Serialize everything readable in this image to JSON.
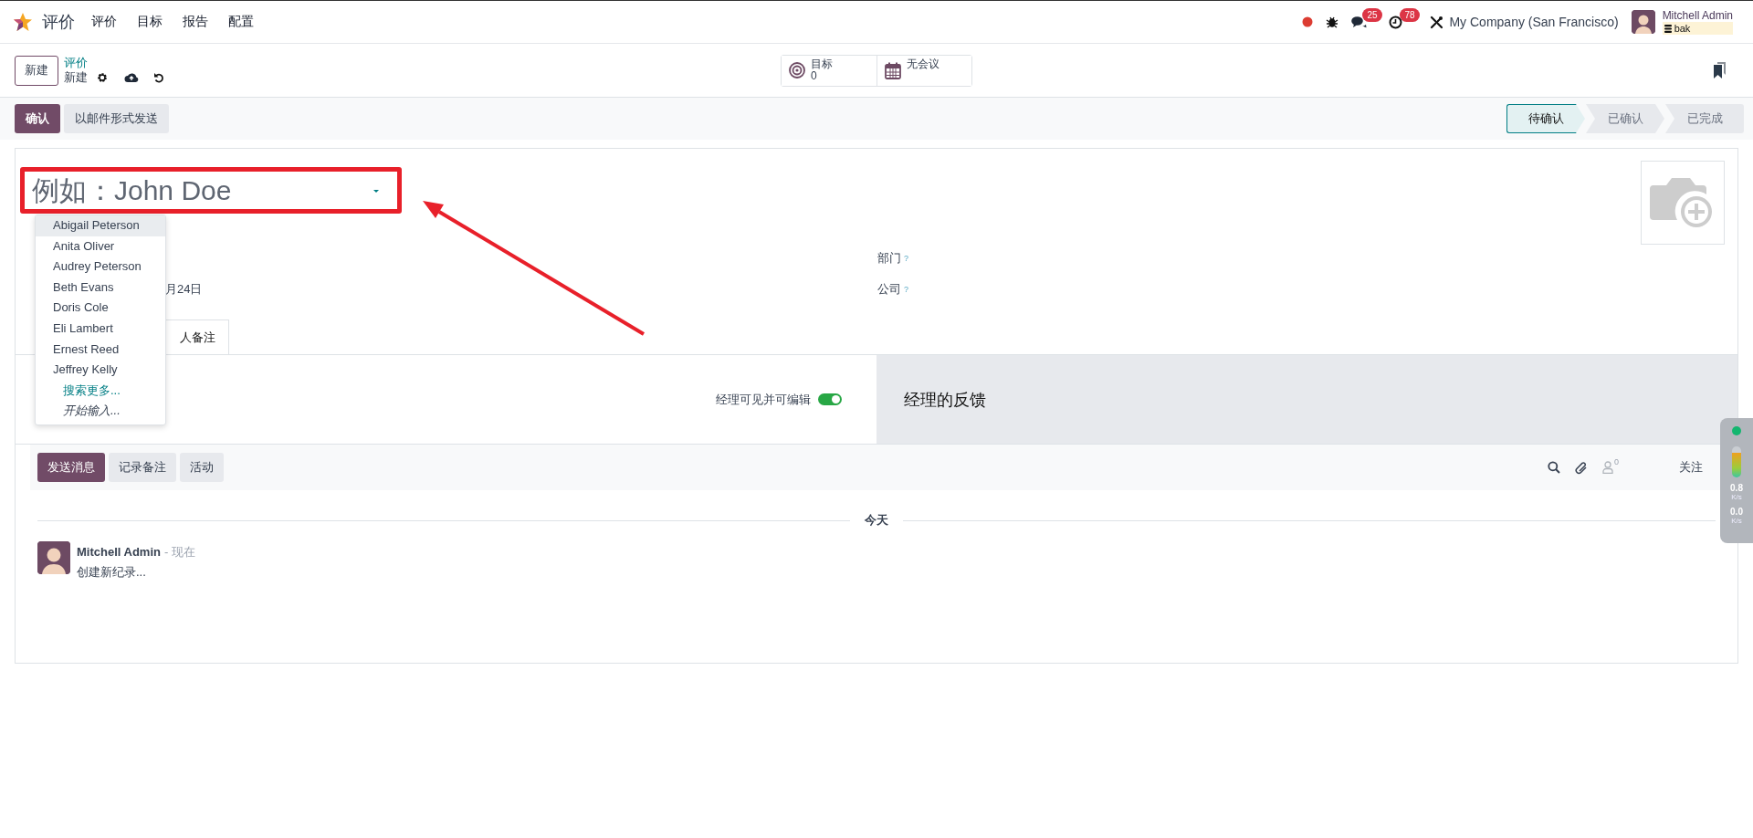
{
  "navbar": {
    "app_name": "评价",
    "menu": [
      "评价",
      "目标",
      "报告",
      "配置"
    ],
    "systray": {
      "chat_count": "25",
      "activity_count": "78",
      "company": "My Company (San Francisco)",
      "user": "Mitchell Admin",
      "database": "bak"
    }
  },
  "control_panel": {
    "new_button": "新建",
    "breadcrumb": "评价",
    "record": "新建",
    "smart_buttons": [
      {
        "kind": "goal",
        "label": "目标",
        "value": "0"
      },
      {
        "kind": "meeting",
        "label": "无会议"
      }
    ]
  },
  "actions": [
    {
      "label": "确认",
      "selected": true
    },
    {
      "label": "以邮件形式发送",
      "selected": false
    }
  ],
  "statusbar": [
    {
      "label": "待确认",
      "selected": true
    },
    {
      "label": "已确认",
      "selected": false
    },
    {
      "label": "已完成",
      "selected": false
    }
  ],
  "form": {
    "name_placeholder": "例如：John Doe",
    "date_fragment": "月24日",
    "fields_right": [
      {
        "label": "部门",
        "help": "?"
      },
      {
        "label": "公司",
        "help": "?"
      }
    ],
    "tab_fragment": "人备注",
    "toggle": {
      "label": "经理可见并可编辑",
      "on": true
    },
    "feedback_title": "经理的反馈"
  },
  "dropdown": {
    "items": [
      {
        "label": "Abigail Peterson",
        "selected": true
      },
      {
        "label": "Anita Oliver",
        "selected": false
      },
      {
        "label": "Audrey Peterson",
        "selected": false
      },
      {
        "label": "Beth Evans",
        "selected": false
      },
      {
        "label": "Doris Cole",
        "selected": false
      },
      {
        "label": "Eli Lambert",
        "selected": false
      },
      {
        "label": "Ernest Reed",
        "selected": false
      },
      {
        "label": "Jeffrey Kelly",
        "selected": false
      }
    ],
    "search_more": "搜索更多...",
    "start_typing": "开始输入..."
  },
  "chatter": {
    "buttons": [
      {
        "label": "发送消息",
        "selected": true
      },
      {
        "label": "记录备注",
        "selected": false
      },
      {
        "label": "活动",
        "selected": false
      }
    ],
    "follower_count": "0",
    "follow": "关注",
    "date_separator": "今天",
    "messages": [
      {
        "author": "Mitchell Admin",
        "time": "- 现在",
        "body": "创建新纪录..."
      }
    ]
  },
  "speed_widget": {
    "upload": "0.8",
    "upload_unit": "K/s",
    "download": "0.0",
    "download_unit": "K/s"
  }
}
